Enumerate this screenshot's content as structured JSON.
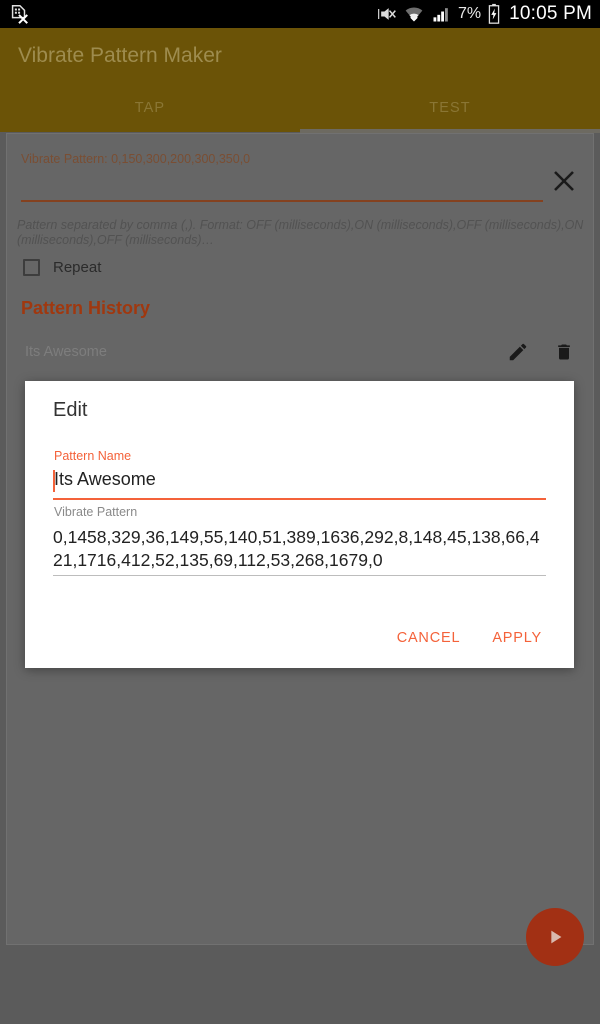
{
  "statusbar": {
    "icons": [
      "sim-card-missing-icon",
      "mute-icon",
      "wifi-icon",
      "signal-icon",
      "battery-charging-icon"
    ],
    "battery_percent": "7%",
    "clock": "10:05 PM"
  },
  "appbar": {
    "title": "Vibrate Pattern Maker",
    "background_color": "#6b5307",
    "tabs": [
      {
        "label": "TAP",
        "active": false
      },
      {
        "label": "TEST",
        "active": true
      }
    ]
  },
  "main": {
    "pattern_input": {
      "label": "Vibrate Pattern: 0,150,300,200,300,350,0",
      "value": "",
      "underline_color": "#84411f"
    },
    "close_icon": "close-icon",
    "hint": "Pattern separated by comma (,). Format: OFF (milliseconds),ON (milliseconds),OFF (milliseconds),ON (milliseconds),OFF (milliseconds)…",
    "repeat": {
      "label": "Repeat",
      "checked": false
    },
    "history": {
      "title": "Pattern History",
      "title_color": "#a0380f",
      "rows": [
        {
          "name": "Its Awesome",
          "edit_icon": "pencil-icon",
          "delete_icon": "trash-icon"
        },
        {
          "name": "",
          "edit_icon": "pencil-icon",
          "delete_icon": "trash-icon"
        }
      ]
    },
    "fab": {
      "icon": "play-icon",
      "color": "#a23014"
    }
  },
  "dialog": {
    "title": "Edit",
    "name_field": {
      "label": "Pattern Name",
      "value": "Its Awesome"
    },
    "pattern_field": {
      "label": "Vibrate Pattern",
      "value": "0,1458,329,36,149,55,140,51,389,1636,292,8,148,45,138,66,421,1716,412,52,135,69,112,53,268,1679,0"
    },
    "cancel_label": "CANCEL",
    "apply_label": "APPLY",
    "accent_color": "#f4623a"
  }
}
